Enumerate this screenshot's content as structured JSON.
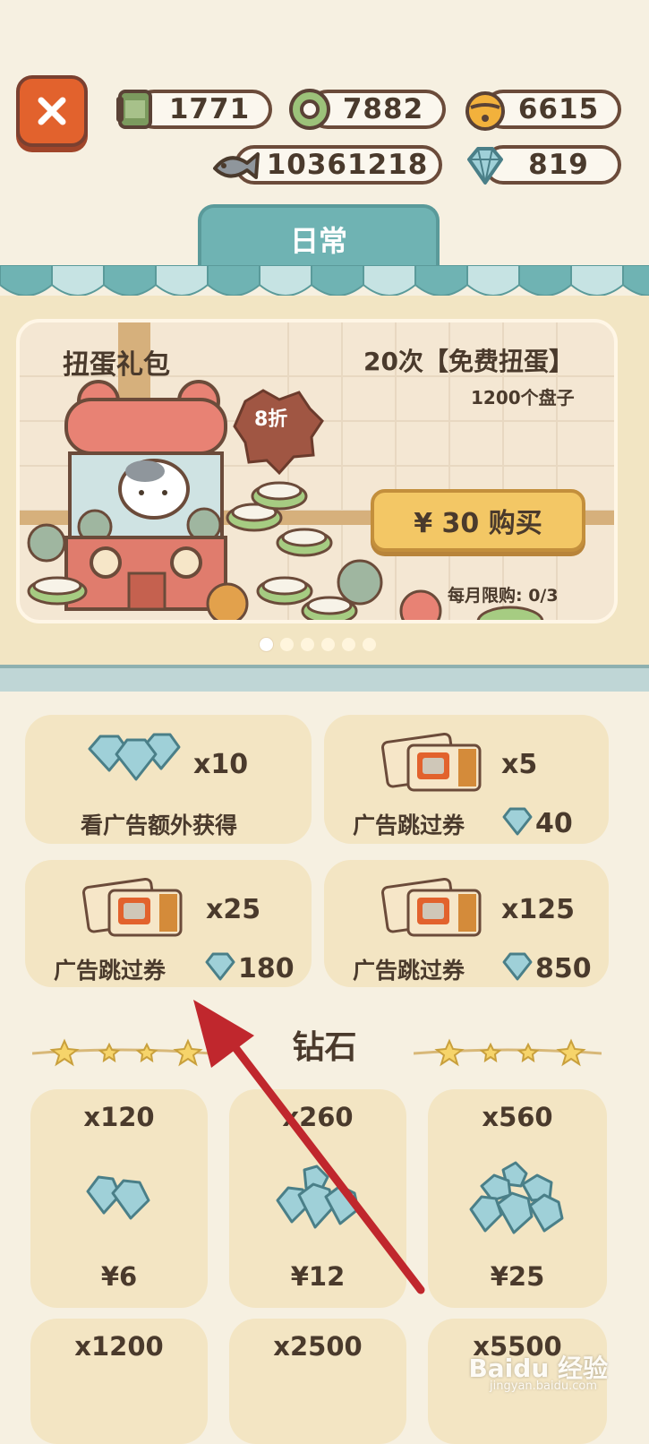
{
  "currencies": {
    "cans": "1771",
    "rings": "7882",
    "bells": "6615",
    "fish": "10361218",
    "diamonds": "819"
  },
  "tab": {
    "label": "日常"
  },
  "banner": {
    "title": "扭蛋礼包",
    "subtitle": "20次【免费扭蛋】",
    "subtitle2": "1200个盘子",
    "discount": "8折",
    "buy_label": "¥ 30 购买",
    "limit": "每月限购: 0/3",
    "pages": 6,
    "active_page": 0
  },
  "items": [
    {
      "qty": "x10",
      "label": "看广告额外获得",
      "price": ""
    },
    {
      "qty": "x5",
      "label": "广告跳过券",
      "price": "40"
    },
    {
      "qty": "x25",
      "label": "广告跳过券",
      "price": "180"
    },
    {
      "qty": "x125",
      "label": "广告跳过券",
      "price": "850"
    }
  ],
  "section": {
    "title": "钻石"
  },
  "gem_packs": [
    {
      "qty": "x120",
      "price": "¥6"
    },
    {
      "qty": "x260",
      "price": "¥12"
    },
    {
      "qty": "x560",
      "price": "¥25"
    },
    {
      "qty": "x1200",
      "price": ""
    },
    {
      "qty": "x2500",
      "price": ""
    },
    {
      "qty": "x5500",
      "price": ""
    }
  ],
  "watermark": {
    "text": "Baidu 经验",
    "url": "jingyan.baidu.com"
  },
  "colors": {
    "background": "#f6f0e1",
    "card": "#f3e5c3",
    "accent_teal": "#6fb3b3",
    "close_orange": "#e2622d",
    "buy_yellow": "#f3c765",
    "annotation_arrow": "#c0272d"
  }
}
